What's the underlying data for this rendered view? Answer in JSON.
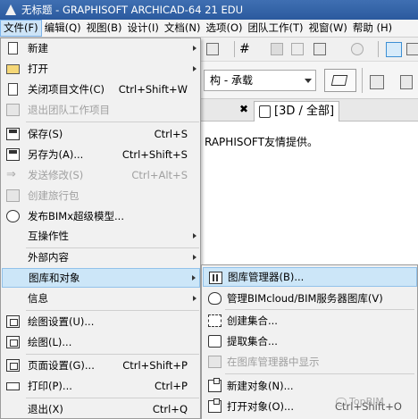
{
  "window": {
    "title": "无标题 - GRAPHISOFT ARCHICAD-64 21 EDU"
  },
  "menubar": [
    {
      "label": "文件(F)",
      "active": true
    },
    {
      "label": "编辑(Q)"
    },
    {
      "label": "视图(B)"
    },
    {
      "label": "设计(I)"
    },
    {
      "label": "文档(N)"
    },
    {
      "label": "选项(O)"
    },
    {
      "label": "团队工作(T)"
    },
    {
      "label": "视窗(W)"
    },
    {
      "label": "帮助 (H)"
    }
  ],
  "toolbar": {
    "layer_combo_value": "构 - 承载"
  },
  "view_tab": {
    "label": "[3D / 全部]",
    "close_glyph": "✖"
  },
  "canvas": {
    "text": "RAPHISOFT友情提供。"
  },
  "file_menu": {
    "items": [
      {
        "label": "新建",
        "shortcut": "",
        "submenu": true,
        "disabled": false,
        "icon": "new-document-icon"
      },
      {
        "label": "打开",
        "shortcut": "",
        "submenu": true,
        "disabled": false,
        "icon": "open-folder-icon"
      },
      {
        "label": "关闭项目文件(C)",
        "shortcut": "Ctrl+Shift+W",
        "submenu": false,
        "disabled": false,
        "icon": "close-document-icon"
      },
      {
        "label": "退出团队工作项目",
        "shortcut": "",
        "submenu": false,
        "disabled": true,
        "icon": "leave-teamwork-icon"
      },
      {
        "label": "保存(S)",
        "shortcut": "Ctrl+S",
        "submenu": false,
        "disabled": false,
        "icon": "save-icon"
      },
      {
        "label": "另存为(A)...",
        "shortcut": "Ctrl+Shift+S",
        "submenu": false,
        "disabled": false,
        "icon": "save-as-icon"
      },
      {
        "label": "发送修改(S)",
        "shortcut": "Ctrl+Alt+S",
        "submenu": false,
        "disabled": true,
        "icon": "send-changes-icon"
      },
      {
        "label": "创建旅行包",
        "shortcut": "",
        "submenu": false,
        "disabled": true,
        "icon": "travel-pack-icon"
      },
      {
        "label": "发布BIMx超级模型...",
        "shortcut": "",
        "submenu": false,
        "disabled": false,
        "icon": "bimx-icon"
      },
      {
        "label": "互操作性",
        "shortcut": "",
        "submenu": true,
        "disabled": false,
        "icon": ""
      },
      {
        "label": "外部内容",
        "shortcut": "",
        "submenu": true,
        "disabled": false,
        "icon": ""
      },
      {
        "label": "图库和对象",
        "shortcut": "",
        "submenu": true,
        "disabled": false,
        "icon": "",
        "highlighted": true
      },
      {
        "label": "信息",
        "shortcut": "",
        "submenu": true,
        "disabled": false,
        "icon": ""
      },
      {
        "label": "绘图设置(U)...",
        "shortcut": "",
        "submenu": false,
        "disabled": false,
        "icon": "drawing-settings-icon"
      },
      {
        "label": "绘图(L)...",
        "shortcut": "",
        "submenu": false,
        "disabled": false,
        "icon": "plot-icon"
      },
      {
        "label": "页面设置(G)...",
        "shortcut": "Ctrl+Shift+P",
        "submenu": false,
        "disabled": false,
        "icon": "page-setup-icon"
      },
      {
        "label": "打印(P)...",
        "shortcut": "Ctrl+P",
        "submenu": false,
        "disabled": false,
        "icon": "printer-icon"
      },
      {
        "label": "退出(X)",
        "shortcut": "Ctrl+Q",
        "submenu": false,
        "disabled": false,
        "icon": ""
      }
    ]
  },
  "library_submenu": {
    "items": [
      {
        "label": "图库管理器(B)...",
        "disabled": false,
        "highlighted": true,
        "icon": "library-manager-icon"
      },
      {
        "label": "管理BIMcloud/BIM服务器图库(V)",
        "disabled": false,
        "icon": "bimcloud-icon"
      },
      {
        "label": "创建集合...",
        "disabled": false,
        "icon": "create-set-icon"
      },
      {
        "label": "提取集合...",
        "disabled": false,
        "icon": "extract-set-icon"
      },
      {
        "label": "在图库管理器中显示",
        "disabled": true,
        "icon": "show-in-library-icon"
      },
      {
        "label": "新建对象(N)...",
        "disabled": false,
        "icon": "new-object-icon"
      },
      {
        "label": "打开对象(O)...",
        "disabled": false,
        "icon": "open-object-icon"
      }
    ],
    "partial_shortcut": "Ctrl+Shift+O"
  },
  "watermark": {
    "text": "TopBIM"
  }
}
